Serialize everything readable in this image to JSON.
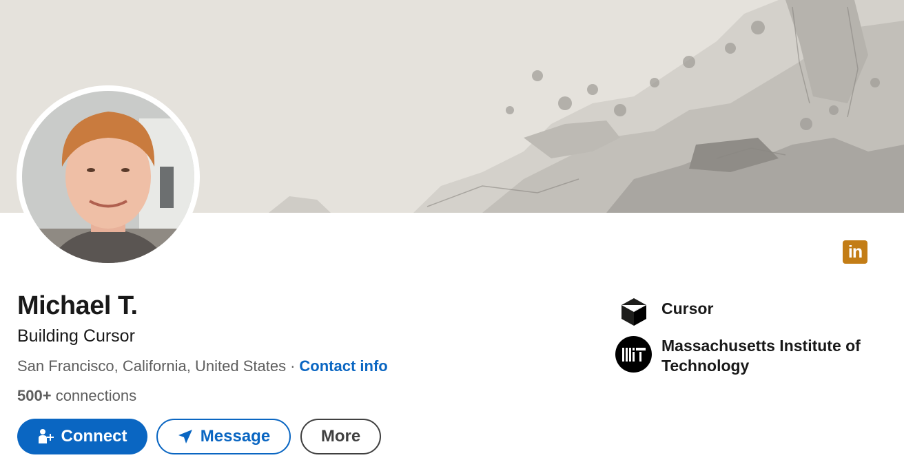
{
  "profile": {
    "name": "Michael T.",
    "headline": "Building Cursor",
    "location": "San Francisco, California, United States",
    "separator": "·",
    "contact_info": "Contact info",
    "connections_count": "500+",
    "connections_label": "connections"
  },
  "actions": {
    "connect": "Connect",
    "message": "Message",
    "more": "More"
  },
  "badge": {
    "label": "in"
  },
  "orgs": [
    {
      "name": "Cursor",
      "icon": "cursor-logo-icon"
    },
    {
      "name": "Massachusetts Institute of Technology",
      "icon": "mit-logo-icon",
      "logo_text": "MIT"
    }
  ],
  "colors": {
    "brand_blue": "#0a66c2",
    "badge": "#c37d16"
  }
}
